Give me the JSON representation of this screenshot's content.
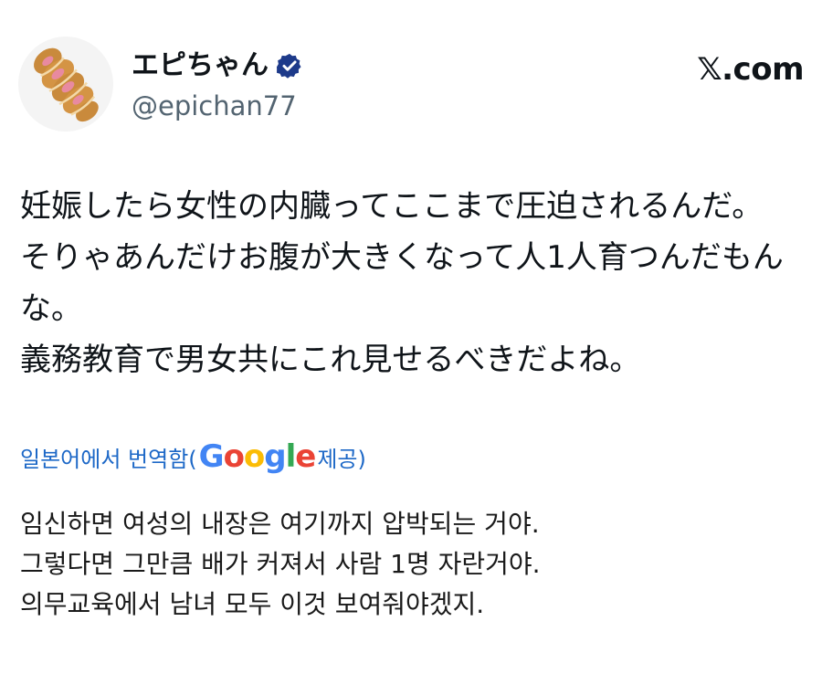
{
  "author": {
    "display_name": "エピちゃん",
    "handle": "@epichan77",
    "verified": true,
    "verified_color": "#1d3a8a",
    "avatar_icon": "braided-bread-icon"
  },
  "brand": {
    "label": "𝕏.com"
  },
  "post": {
    "lines": [
      "妊娠したら女性の内臓ってここまで圧迫されるんだ。",
      "そりゃあんだけお腹が大きくなって人1人育つんだもん",
      "な。",
      "義務教育で男女共にこれ見せるべきだよね。"
    ]
  },
  "translation": {
    "prefix": "일본어에서 번역함(",
    "provider_letters": [
      "G",
      "o",
      "o",
      "g",
      "l",
      "e"
    ],
    "provider_colors": [
      "#4285F4",
      "#EA4335",
      "#FBBC05",
      "#4285F4",
      "#34A853",
      "#EA4335"
    ],
    "suffix": " 제공)",
    "link_color": "#1d68c7",
    "lines": [
      "임신하면 여성의 내장은 여기까지 압박되는 거야.",
      "그렇다면 그만큼 배가 커져서 사람 1명 자란거야.",
      "의무교육에서 남녀 모두 이것 보여줘야겠지."
    ]
  }
}
